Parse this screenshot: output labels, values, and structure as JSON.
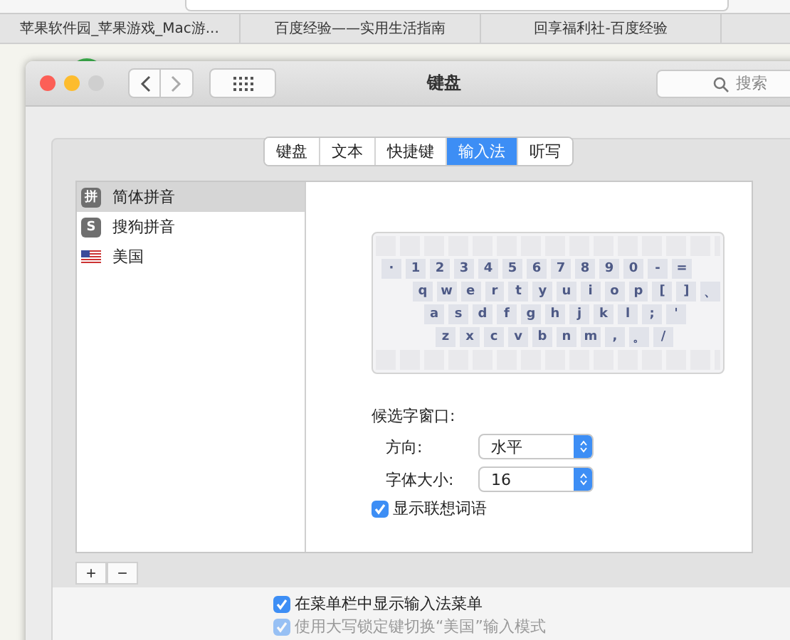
{
  "browser_tabs": [
    {
      "label": "苹果软件园_苹果游戏_Mac游...",
      "selected": false
    },
    {
      "label": "百度经验——实用生活指南",
      "selected": false
    },
    {
      "label": "回享福利社-百度经验",
      "selected": false
    }
  ],
  "window": {
    "title": "键盘",
    "search": {
      "placeholder": "搜索"
    }
  },
  "tabs": [
    {
      "label": "键盘",
      "selected": false
    },
    {
      "label": "文本",
      "selected": false
    },
    {
      "label": "快捷键",
      "selected": false
    },
    {
      "label": "输入法",
      "selected": true
    },
    {
      "label": "听写",
      "selected": false
    }
  ],
  "input_sources": [
    {
      "kind": "badge",
      "icon_text": "拼",
      "label": "简体拼音",
      "selected": true
    },
    {
      "kind": "badge",
      "icon_text": "S",
      "label": "搜狗拼音",
      "selected": false
    },
    {
      "kind": "flag",
      "label": "美国",
      "selected": false
    }
  ],
  "list_buttons": [
    "+",
    "−"
  ],
  "keyboard": {
    "rows": [
      "· 1 2 3 4 5 6 7 8 9 0 - =",
      "q w e r t y u i o p [ ] 、",
      "a s d f g h j k l ; '",
      "z x c v b n m , 。 /"
    ]
  },
  "candidate_window": {
    "heading": "候选字窗口:",
    "fields": [
      {
        "label": "方向:",
        "value": "水平"
      },
      {
        "label": "字体大小:",
        "value": "16"
      }
    ],
    "option": {
      "label": "显示联想词语",
      "checked": true
    }
  },
  "bottom_options": [
    {
      "label": "在菜单栏中显示输入法菜单",
      "checked": true,
      "disabled": false
    },
    {
      "label": "使用大写锁定键切换“美国”输入模式",
      "checked": true,
      "disabled": true
    }
  ]
}
